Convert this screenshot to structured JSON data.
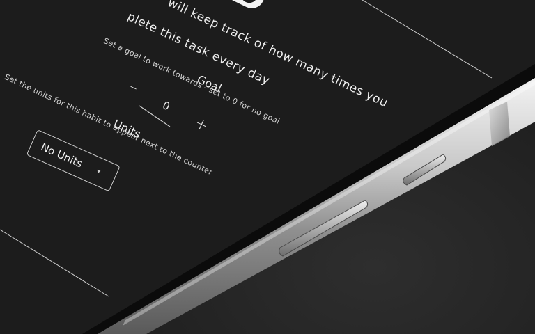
{
  "intro": {
    "line1": "will keep track of how many times you",
    "line2": "plete this task every day"
  },
  "goal": {
    "label": "Goal",
    "description": "Set a goal to work towards - set to 0 for no goal",
    "value": "0",
    "decrement_label": "–",
    "increment_label": "+"
  },
  "units": {
    "label": "Units",
    "description": "Set the units for this habit to appear next to the counter",
    "selected": "No Units",
    "caret": "▾"
  },
  "colors": {
    "screen_background": "#1c1c1c",
    "text": "#e6e6e6",
    "phone_frame": "#c8c8c8",
    "background": "#1e1e1e"
  },
  "icons": {
    "toggle": "toggle-switch-icon",
    "dropdown": "caret-down-icon"
  }
}
